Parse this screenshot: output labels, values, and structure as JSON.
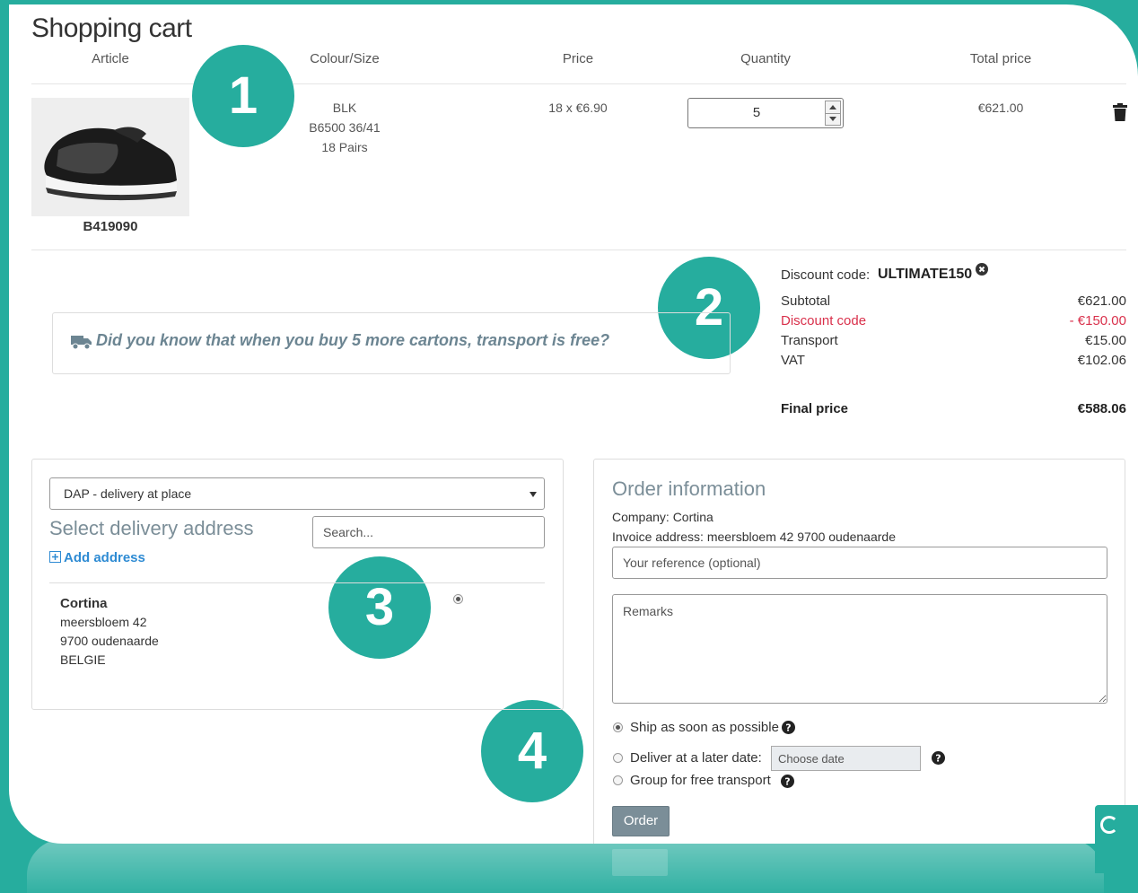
{
  "page": {
    "title": "Shopping cart"
  },
  "table": {
    "headers": [
      "Article",
      "Colour/Size",
      "Price",
      "Quantity",
      "Total price"
    ]
  },
  "item": {
    "sku": "B419090",
    "colour": "BLK",
    "size": "B6500 36/41",
    "pairs": "18 Pairs",
    "price": "18 x €6.90",
    "quantity": "5",
    "total": "€621.00"
  },
  "badges": [
    "1",
    "2",
    "3",
    "4"
  ],
  "tip": {
    "text": "Did you know that when you buy 5 more cartons, transport is free?"
  },
  "summary": {
    "discount_label": "Discount code:",
    "discount_code": "ULTIMATE150",
    "rows": [
      {
        "label": "Subtotal",
        "value": "€621.00"
      },
      {
        "label": "Discount code",
        "value": "- €150.00"
      },
      {
        "label": "Transport",
        "value": "€15.00"
      },
      {
        "label": "VAT",
        "value": "€102.06"
      }
    ],
    "final_label": "Final price",
    "final_value": "€588.06"
  },
  "delivery": {
    "method": "DAP - delivery at place",
    "title": "Select delivery address",
    "search_placeholder": "Search...",
    "add_address": "Add address",
    "address": {
      "name": "Cortina",
      "street": "meersbloem 42",
      "city": "9700 oudenaarde",
      "country": "BELGIE"
    }
  },
  "order": {
    "title": "Order information",
    "company": "Company: Cortina",
    "invoice": "Invoice address: meersbloem 42 9700 oudenaarde",
    "reference_placeholder": "Your reference (optional)",
    "remarks_placeholder": "Remarks",
    "options": {
      "asap": "Ship as soon as possible",
      "later": "Deliver at a later date:",
      "group": "Group for free transport"
    },
    "date_placeholder": "Choose date",
    "button": "Order"
  },
  "colors": {
    "accent": "#26ad9e",
    "link": "#2e8bd3",
    "discount": "#d9304b",
    "heading": "#7b8e98"
  },
  "icons": [
    "truck-icon",
    "trash-icon",
    "close-circle-icon",
    "plus-square-icon",
    "question-icon"
  ]
}
